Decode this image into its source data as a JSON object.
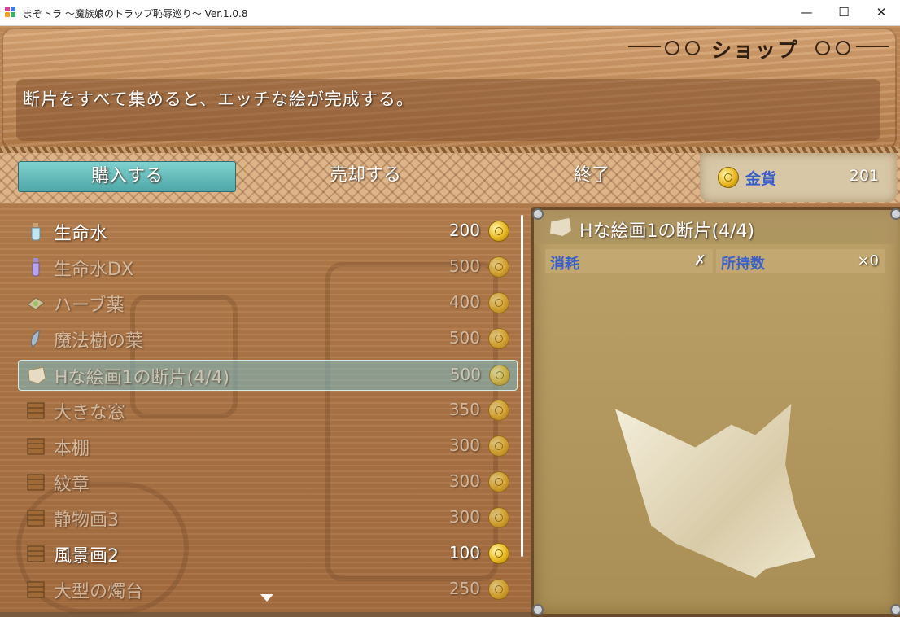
{
  "window": {
    "title": "まぞトラ ～魔族娘のトラップ恥辱巡り～ Ver.1.0.8",
    "minimize_icon": "minimize-icon",
    "maximize_icon": "maximize-icon",
    "close_icon": "close-icon"
  },
  "header": {
    "title": "ショップ",
    "help_text": "断片をすべて集めると、エッチな絵が完成する。"
  },
  "commands": [
    {
      "label": "購入する",
      "selected": true
    },
    {
      "label": "売却する",
      "selected": false
    },
    {
      "label": "終了",
      "selected": false
    }
  ],
  "gold": {
    "label": "金貨",
    "value": "201"
  },
  "items": [
    {
      "name": "生命水",
      "price": "200",
      "icon": "potion-bottle-icon",
      "enabled": true,
      "selected": false
    },
    {
      "name": "生命水DX",
      "price": "500",
      "icon": "potion-purple-icon",
      "enabled": false,
      "selected": false
    },
    {
      "name": "ハーブ薬",
      "price": "400",
      "icon": "herb-medicine-icon",
      "enabled": false,
      "selected": false
    },
    {
      "name": "魔法樹の葉",
      "price": "500",
      "icon": "leaf-icon",
      "enabled": false,
      "selected": false
    },
    {
      "name": "Hな絵画1の断片(4/4)",
      "price": "500",
      "icon": "paper-fragment-icon",
      "enabled": false,
      "selected": true
    },
    {
      "name": "大きな窓",
      "price": "350",
      "icon": "furniture-icon",
      "enabled": false,
      "selected": false
    },
    {
      "name": "本棚",
      "price": "300",
      "icon": "furniture-icon",
      "enabled": false,
      "selected": false
    },
    {
      "name": "紋章",
      "price": "300",
      "icon": "furniture-icon",
      "enabled": false,
      "selected": false
    },
    {
      "name": "静物画3",
      "price": "300",
      "icon": "furniture-icon",
      "enabled": false,
      "selected": false
    },
    {
      "name": "風景画2",
      "price": "100",
      "icon": "furniture-icon",
      "enabled": true,
      "selected": false
    },
    {
      "name": "大型の燭台",
      "price": "250",
      "icon": "furniture-icon",
      "enabled": false,
      "selected": false
    }
  ],
  "detail": {
    "title": "Hな絵画1の断片(4/4)",
    "consume_label": "消耗",
    "consume_value": "✗",
    "owned_label": "所持数",
    "owned_value": "×0"
  },
  "colors": {
    "selected_command": "#5fb8b8",
    "stat_label": "#3b5fc8",
    "gold_coin": "#e8b820"
  }
}
